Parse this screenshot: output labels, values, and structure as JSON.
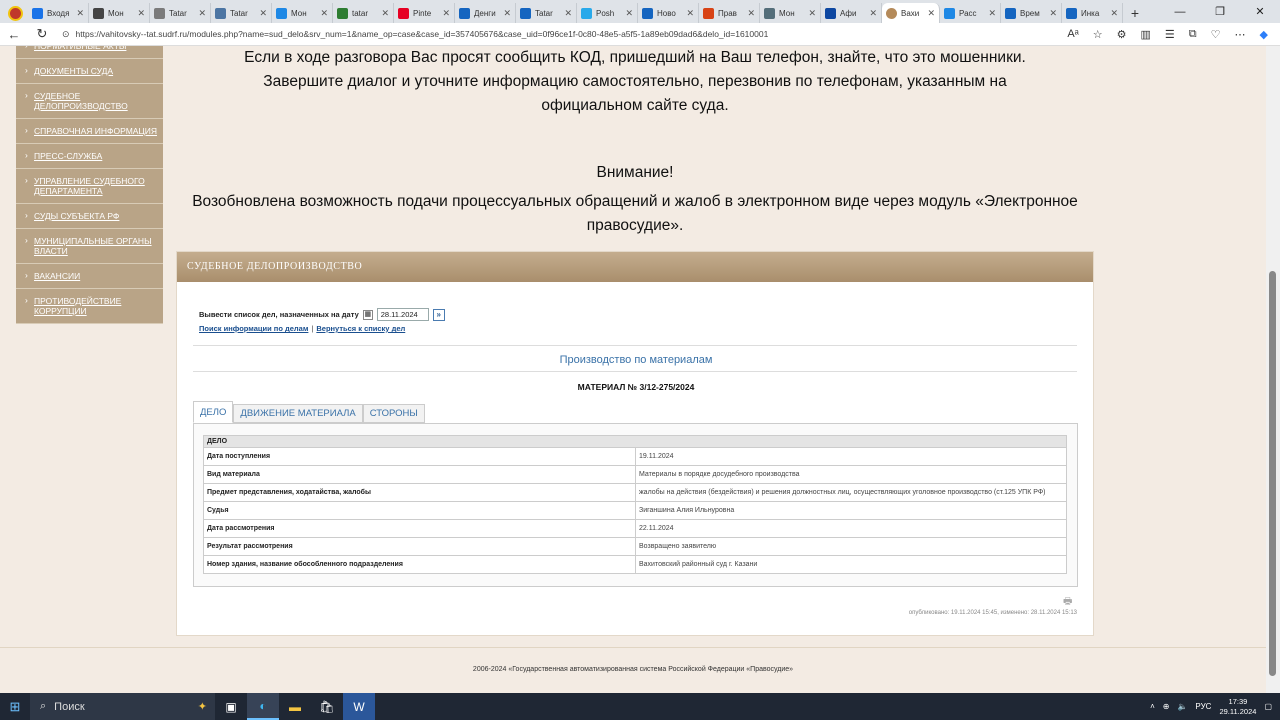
{
  "browser": {
    "tabs": [
      {
        "label": "Входя",
        "color": "#1a73e8"
      },
      {
        "label": "Мон",
        "color": "#444"
      },
      {
        "label": "Tatar",
        "color": "#7b7b7b"
      },
      {
        "label": "Tatar",
        "color": "#4c75a3"
      },
      {
        "label": "Мон",
        "color": "#1e88e5"
      },
      {
        "label": "tatar",
        "color": "#2e7d32"
      },
      {
        "label": "Pinte",
        "color": "#e60023"
      },
      {
        "label": "Денги",
        "color": "#1565c0"
      },
      {
        "label": "Tatar",
        "color": "#1565c0"
      },
      {
        "label": "Posh",
        "color": "#29a9ea"
      },
      {
        "label": "Ново",
        "color": "#1565c0"
      },
      {
        "label": "Прав",
        "color": "#d84315"
      },
      {
        "label": "Мон",
        "color": "#546e7a"
      },
      {
        "label": "Афи",
        "color": "#0d47a1"
      }
    ],
    "active_tab": {
      "label": "Вахи",
      "color": "#b48a5a"
    },
    "tabs_after": [
      {
        "label": "Расс",
        "color": "#1e88e5"
      },
      {
        "label": "Врем",
        "color": "#1565c0"
      },
      {
        "label": "Инка",
        "color": "#1565c0"
      }
    ],
    "url": "https://vahitovsky--tat.sudrf.ru/modules.php?name=sud_delo&srv_num=1&name_op=case&case_id=357405676&case_uid=0f96ce1f-0c80-48e5-a5f5-1a89eb09dad6&delo_id=1610001"
  },
  "sidebar": {
    "items": [
      {
        "label": "Нормативные акты"
      },
      {
        "label": "Документы суда"
      },
      {
        "label": "Судебное делопроизводство"
      },
      {
        "label": "Справочная информация"
      },
      {
        "label": "Пресс-служба"
      },
      {
        "label": "Управление Судебного департамента"
      },
      {
        "label": "Суды субъекта РФ"
      },
      {
        "label": "Муниципальные органы власти"
      },
      {
        "label": "Вакансии"
      },
      {
        "label": "Противодействие коррупции"
      }
    ]
  },
  "notice": {
    "line1": "Если в ходе разговора Вас просят сообщить КОД, пришедший на Ваш телефон, знайте, что это мошенники.",
    "line2": "Завершите диалог и уточните информацию самостоятельно, перезвонив по телефонам, указанным на",
    "line3": "официальном сайте суда.",
    "attention": "Внимание!",
    "line4": "Возобновлена возможность подачи процессуальных обращений и жалоб в электронном виде через модуль «Электронное",
    "line5": "правосудие»."
  },
  "panel": {
    "title": "СУДЕБНОЕ ДЕЛОПРОИЗВОДСТВО",
    "date_label": "Вывести список дел, назначенных на дату",
    "date_value": "28.11.2024",
    "link_search": "Поиск информации по делам",
    "link_sep": "|",
    "link_back": "Вернуться к списку дел",
    "section": "Производство по материалам",
    "material": "МАТЕРИАЛ № 3/12-275/2024",
    "tabs": [
      "ДЕЛО",
      "ДВИЖЕНИЕ МАТЕРИАЛА",
      "СТОРОНЫ"
    ],
    "table_header": "ДЕЛО",
    "rows": [
      {
        "k": "Дата поступления",
        "v": "19.11.2024"
      },
      {
        "k": "Вид материала",
        "v": "Материалы в порядке досудебного производства"
      },
      {
        "k": "Предмет представления, ходатайства, жалобы",
        "v": "жалобы на действия (бездействия) и решения должностных лиц, осуществляющих уголовное производство (ст.125 УПК РФ)"
      },
      {
        "k": "Судья",
        "v": "Зиганшина Алия Ильнуровна"
      },
      {
        "k": "Дата рассмотрения",
        "v": "22.11.2024"
      },
      {
        "k": "Результат рассмотрения",
        "v": "Возвращено заявителю"
      },
      {
        "k": "Номер здания, название обособленного подразделения",
        "v": "Вахитовский районный суд г. Казани"
      }
    ],
    "pubinfo": "опубликовано: 19.11.2024 15:45, изменено: 28.11.2024 15:13"
  },
  "footer": {
    "text": "2006-2024 «Государственная автоматизированная система Российской Федерации «Правосудие»"
  },
  "taskbar": {
    "search": "Поиск",
    "lang": "РУС",
    "time": "17:39",
    "date": "29.11.2024"
  }
}
